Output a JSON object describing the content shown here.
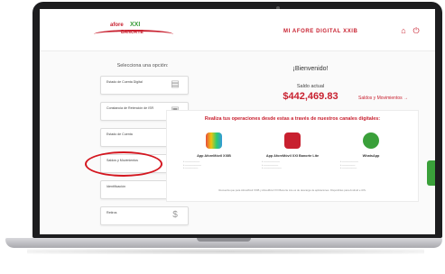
{
  "header": {
    "brand_title": "MI AFORE DIGITAL XXIB",
    "logo": {
      "word1": "afore",
      "word2": "XXI",
      "word3": "BANORTE"
    }
  },
  "sidebar": {
    "title": "Selecciona una opción:",
    "items": [
      {
        "label": "Estado de Cuenta Digital",
        "icon": "document-icon"
      },
      {
        "label": "Constancia de Retención de ISR",
        "icon": "certificate-icon"
      },
      {
        "label": "Estado de Cuenta",
        "icon": "document-icon"
      },
      {
        "label": "Saldos y Movimientos",
        "icon": "qr-icon"
      },
      {
        "label": "Identificación",
        "icon": "hand-icon"
      },
      {
        "label": "Retiros",
        "icon": "money-icon"
      }
    ]
  },
  "main": {
    "welcome": "¡Bienvenido!",
    "saldo_label": "Saldo actual",
    "saldo_value": "$442,469.83",
    "saldos_link": "Saldos y Movimientos →"
  },
  "channels": {
    "title": "Realiza tus operaciones desde estas a través de nuestros canales digitales:",
    "items": [
      {
        "name": "App AforeMóvil XXIB",
        "color": "#c8202f"
      },
      {
        "name": "App AforeMóvil XXI Banorte Lite",
        "color": "#c8202f"
      },
      {
        "name": "WhatsApp",
        "color": "#3aa03a"
      }
    ],
    "note": "Recuerda que para AforeMóvil XXIB y AforeMóvil XXI Banorte Lite es de descarga de aplicaciones. Disponibles para Android e iOS."
  },
  "colors": {
    "brand_red": "#c8202f",
    "whatsapp_green": "#3aa03a",
    "highlight": "#d4161f"
  }
}
